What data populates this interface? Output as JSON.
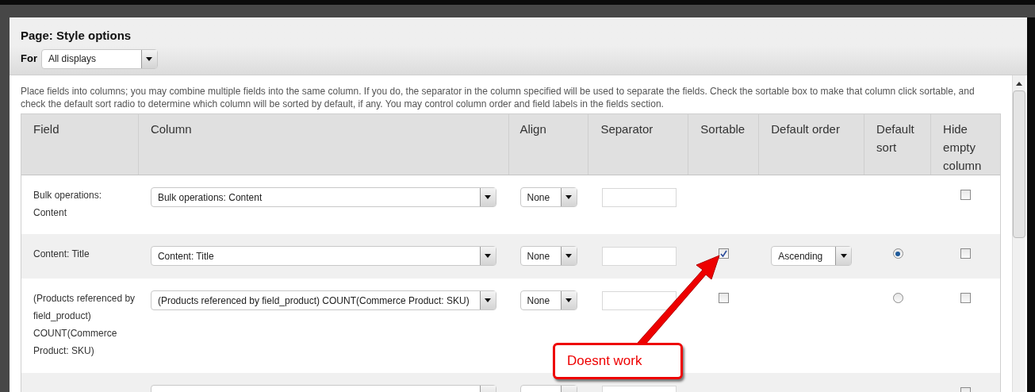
{
  "dialog": {
    "title": "Page: Style options",
    "for_label": "For",
    "for_value": "All displays"
  },
  "description": "Place fields into columns; you may combine multiple fields into the same column. If you do, the separator in the column specified will be used to separate the fields. Check the sortable box to make that column click sortable, and check the default sort radio to determine which column will be sorted by default, if any. You may control column order and field labels in the fields section.",
  "table": {
    "columns": [
      "Field",
      "Column",
      "Align",
      "Separator",
      "Sortable",
      "Default order",
      "Default sort",
      "Hide empty column"
    ],
    "rows": [
      {
        "field": "Bulk operations: Content",
        "column": "Bulk operations: Content",
        "align": "None",
        "hide_empty": false
      },
      {
        "field": "Content: Title",
        "column": "Content: Title",
        "align": "None",
        "sortable": true,
        "default_order": "Ascending",
        "default_sort": true,
        "hide_empty": false
      },
      {
        "field": "(Products referenced by field_product) COUNT(Commerce Product: SKU)",
        "column": "(Products referenced by field_product) COUNT(Commerce Product: SKU)",
        "align": "None",
        "sortable": false,
        "default_sort": false,
        "hide_empty": false
      },
      {
        "hide_empty": false
      }
    ]
  },
  "annotation": {
    "text": "Doesnt work"
  }
}
